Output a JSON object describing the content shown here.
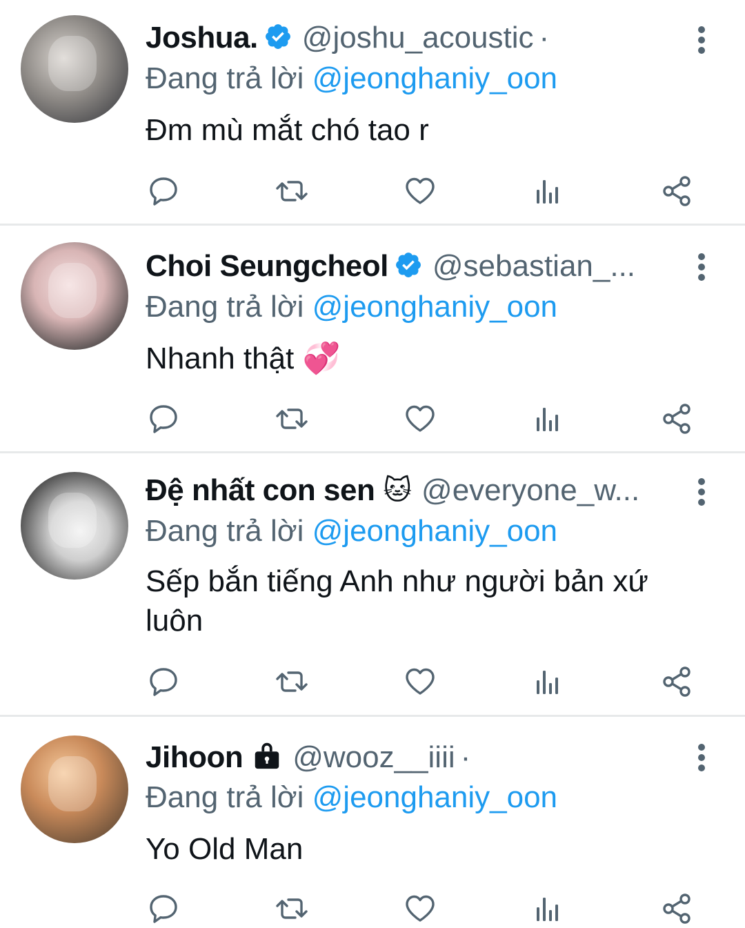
{
  "tweets": [
    {
      "name": "Joshua.",
      "verified": true,
      "handle": "@joshu_acoustic",
      "separator": "·",
      "replying_label": "Đang trả lời",
      "replying_to": "@jeonghaniy_oon",
      "text": "Đm mù mắt chó tao r"
    },
    {
      "name": "Choi Seungcheol",
      "verified": true,
      "handle": "@sebastian_...",
      "replying_label": "Đang trả lời",
      "replying_to": "@jeonghaniy_oon",
      "text": "Nhanh thật 💞"
    },
    {
      "name": "Đệ nhất con sen",
      "name_emoji": "🐱",
      "handle": "@everyone_w...",
      "replying_label": "Đang trả lời",
      "replying_to": "@jeonghaniy_oon",
      "text": "Sếp bắn tiếng Anh như người bản xứ luôn"
    },
    {
      "name": "Jihoon",
      "protected": true,
      "handle": "@wooz__iiii",
      "separator": "·",
      "replying_label": "Đang trả lời",
      "replying_to": "@jeonghaniy_oon",
      "text": "Yo Old Man"
    }
  ],
  "icons": {
    "reply": "reply-icon",
    "retweet": "retweet-icon",
    "like": "like-icon",
    "views": "views-icon",
    "share": "share-icon",
    "more": "more-options-icon",
    "verified": "verified-badge-icon",
    "lock": "lock-icon"
  },
  "colors": {
    "link": "#1d9bf0",
    "secondary_text": "#536471",
    "primary_text": "#0f1419",
    "divider": "#e7e9ea",
    "verified": "#1d9bf0"
  }
}
